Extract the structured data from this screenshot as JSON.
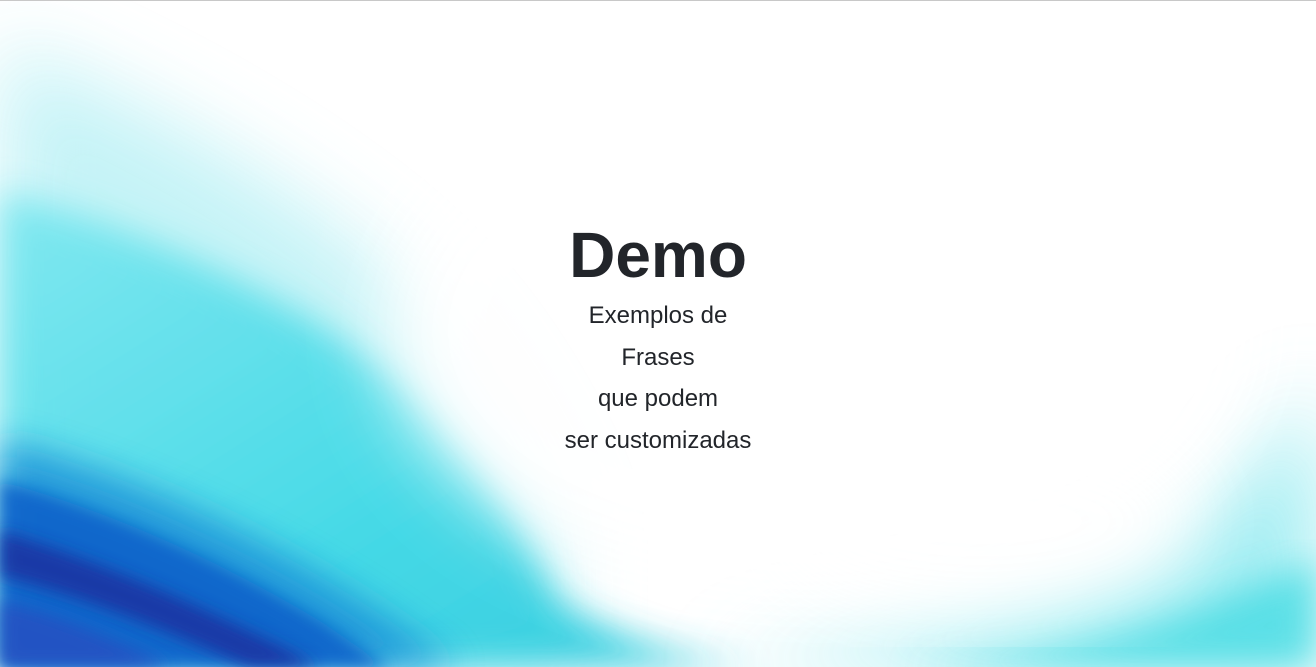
{
  "hero": {
    "title": "Demo",
    "lines": [
      "Exemplos de",
      "Frases",
      "que podem",
      "ser customizadas"
    ]
  },
  "colors": {
    "background": "#ffffff",
    "text": "#22252a",
    "wave_cyan": "#3fd8e6",
    "wave_blue": "#0a5ec9",
    "wave_dark_blue": "#1a2f9e"
  }
}
